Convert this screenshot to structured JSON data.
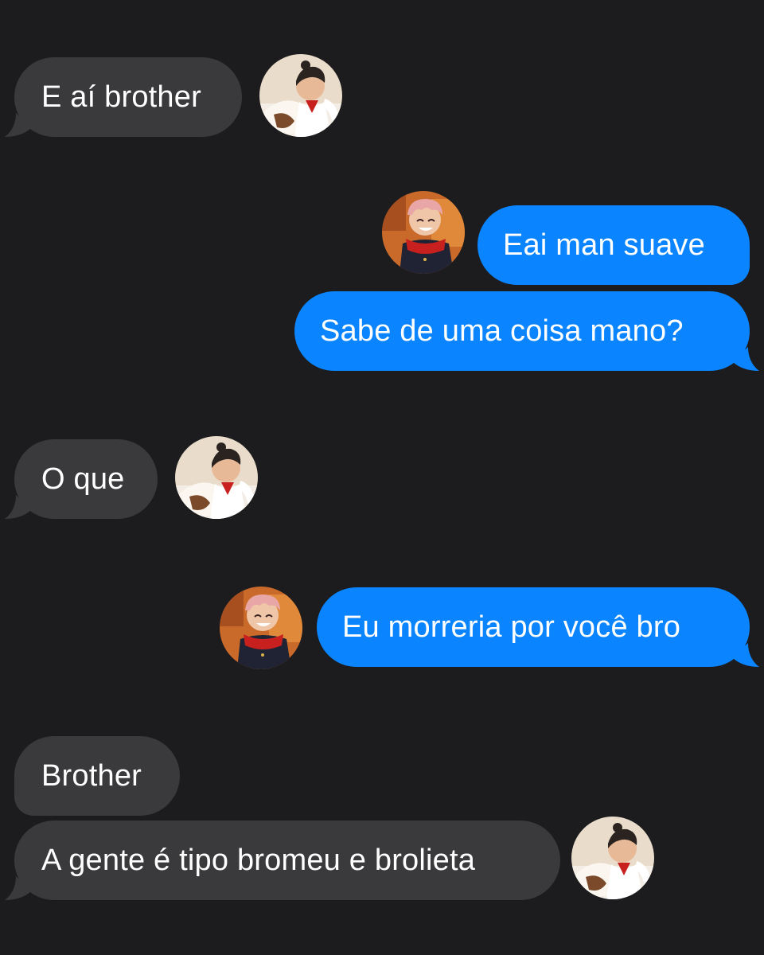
{
  "colors": {
    "background": "#1c1c1e",
    "incoming_bubble": "#3a3a3c",
    "outgoing_bubble": "#0a84ff",
    "text": "#ffffff"
  },
  "messages": [
    {
      "text": "E aí brother",
      "sender": "incoming",
      "avatar": "dark-haired-anime-boy-avatar"
    },
    {
      "text": "Eai man suave",
      "sender": "outgoing",
      "avatar": "pink-haired-anime-boy-avatar"
    },
    {
      "text": "Sabe de uma coisa mano?",
      "sender": "outgoing"
    },
    {
      "text": "O que",
      "sender": "incoming",
      "avatar": "dark-haired-anime-boy-avatar"
    },
    {
      "text": "Eu morreria por você bro",
      "sender": "outgoing",
      "avatar": "pink-haired-anime-boy-avatar"
    },
    {
      "text": "Brother",
      "sender": "incoming"
    },
    {
      "text": "A gente é tipo bromeu e brolieta",
      "sender": "incoming",
      "avatar": "dark-haired-anime-boy-avatar"
    }
  ]
}
